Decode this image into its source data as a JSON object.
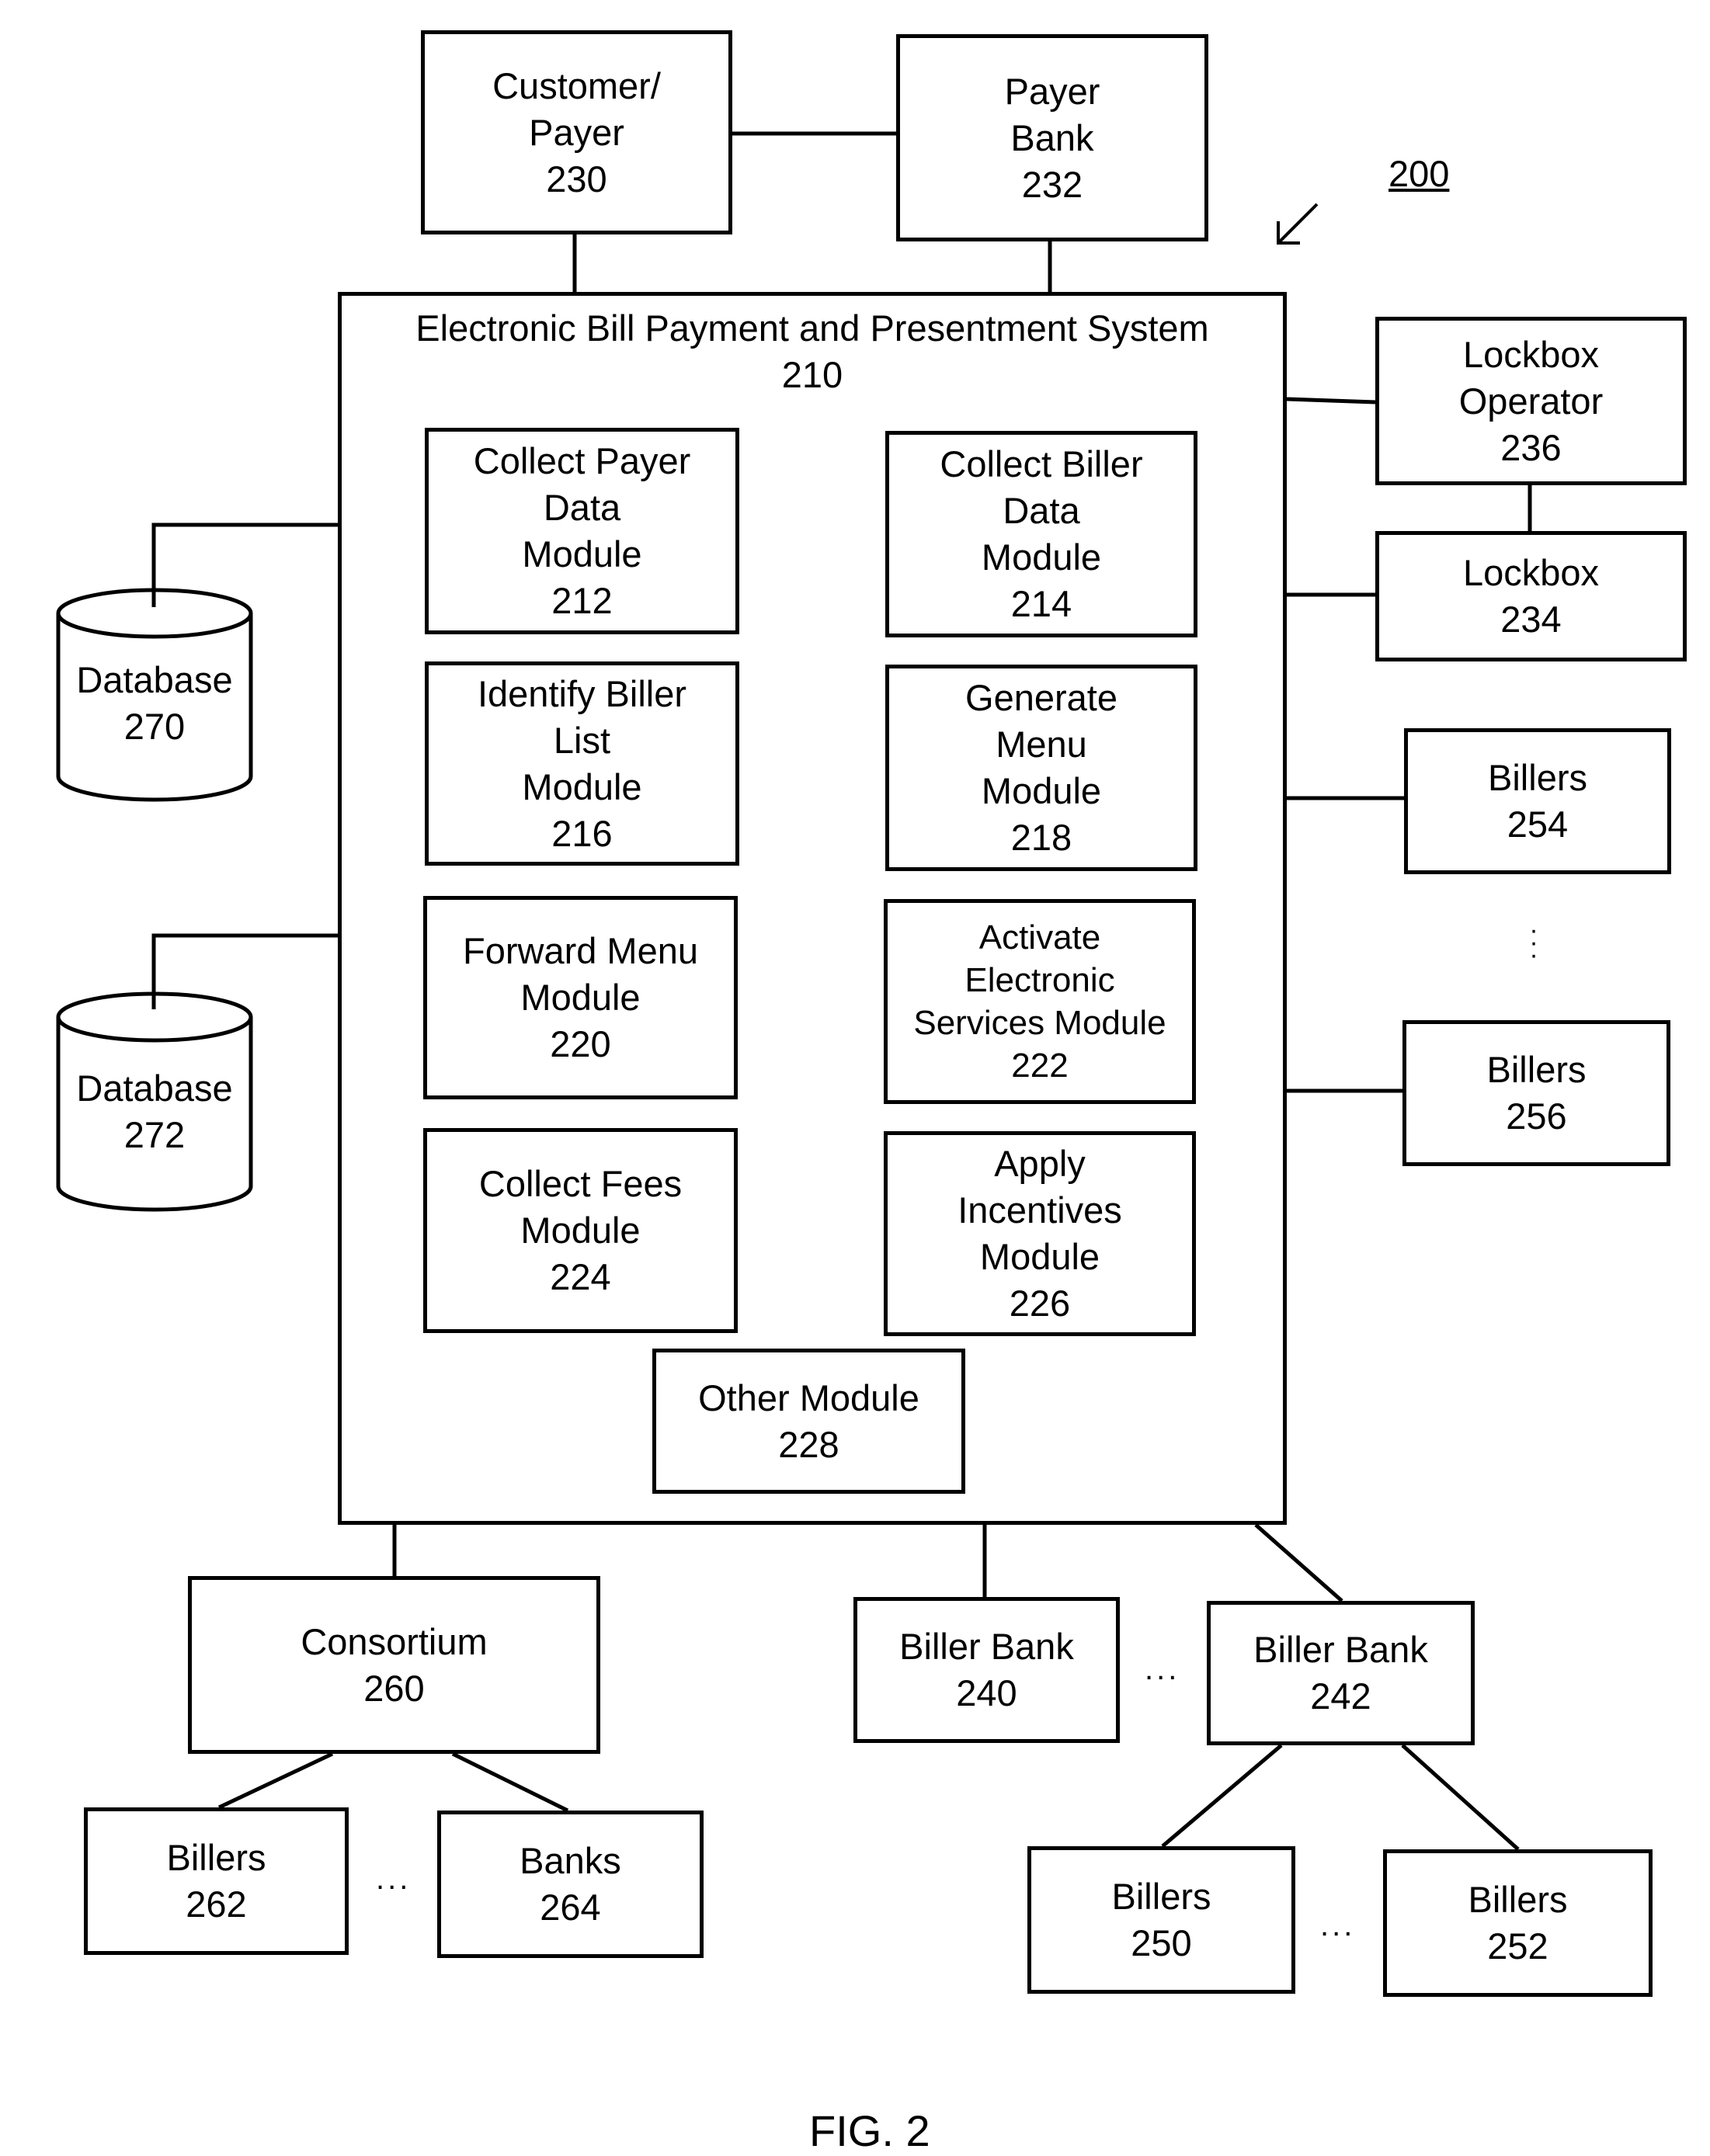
{
  "figure": {
    "reference_number": "200",
    "caption": "FIG. 2"
  },
  "main_system": {
    "title": "Electronic Bill Payment and Presentment System",
    "number": "210",
    "modules": [
      {
        "lines": [
          "Collect Payer",
          "Data",
          "Module"
        ],
        "number": "212"
      },
      {
        "lines": [
          "Collect Biller",
          "Data",
          "Module"
        ],
        "number": "214"
      },
      {
        "lines": [
          "Identify Biller",
          "List",
          "Module"
        ],
        "number": "216"
      },
      {
        "lines": [
          "Generate",
          "Menu",
          "Module"
        ],
        "number": "218"
      },
      {
        "lines": [
          "Forward Menu",
          "Module"
        ],
        "number": "220"
      },
      {
        "lines": [
          "Activate",
          "Electronic",
          "Services Module"
        ],
        "number": "222"
      },
      {
        "lines": [
          "Collect Fees",
          "Module"
        ],
        "number": "224"
      },
      {
        "lines": [
          "Apply",
          "Incentives",
          "Module"
        ],
        "number": "226"
      },
      {
        "lines": [
          "Other Module"
        ],
        "number": "228"
      }
    ]
  },
  "entities": {
    "customer_payer": {
      "lines": [
        "Customer/",
        "Payer"
      ],
      "number": "230"
    },
    "payer_bank": {
      "lines": [
        "Payer",
        "Bank"
      ],
      "number": "232"
    },
    "lockbox_operator": {
      "lines": [
        "Lockbox",
        "Operator"
      ],
      "number": "236"
    },
    "lockbox": {
      "lines": [
        "Lockbox"
      ],
      "number": "234"
    },
    "billers_254": {
      "lines": [
        "Billers"
      ],
      "number": "254"
    },
    "billers_256": {
      "lines": [
        "Billers"
      ],
      "number": "256"
    },
    "database_270": {
      "lines": [
        "Database"
      ],
      "number": "270"
    },
    "database_272": {
      "lines": [
        "Database"
      ],
      "number": "272"
    },
    "consortium": {
      "lines": [
        "Consortium"
      ],
      "number": "260"
    },
    "billers_262": {
      "lines": [
        "Billers"
      ],
      "number": "262"
    },
    "banks_264": {
      "lines": [
        "Banks"
      ],
      "number": "264"
    },
    "biller_bank_240": {
      "lines": [
        "Biller Bank"
      ],
      "number": "240"
    },
    "biller_bank_242": {
      "lines": [
        "Biller Bank"
      ],
      "number": "242"
    },
    "billers_250": {
      "lines": [
        "Billers"
      ],
      "number": "250"
    },
    "billers_252": {
      "lines": [
        "Billers"
      ],
      "number": "252"
    }
  },
  "ellipsis": "..."
}
